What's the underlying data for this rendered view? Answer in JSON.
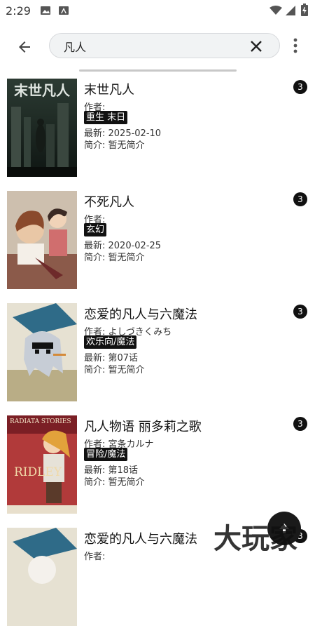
{
  "status_bar": {
    "time": "2:29"
  },
  "search": {
    "value": "凡人"
  },
  "results": [
    {
      "title": "末世凡人",
      "author": "作者:",
      "tags": "重生 末日",
      "latest": "最新: 2025-02-10",
      "intro": "简介: 暂无简介",
      "count": "3",
      "cover_text": "末世凡人"
    },
    {
      "title": "不死凡人",
      "author": "作者:",
      "tags": "玄幻",
      "latest": "最新: 2020-02-25",
      "intro": "简介: 暂无简介",
      "count": "3"
    },
    {
      "title": "恋爱的凡人与六魔法",
      "author": "作者: よしづきくみち",
      "tags": "欢乐向/魔法",
      "latest": "最新: 第07话",
      "intro": "简介: 暂无简介",
      "count": "3"
    },
    {
      "title": "凡人物语 丽多莉之歌",
      "author": "作者: 宮条カルナ",
      "tags": "冒险/魔法",
      "latest": "最新: 第18话",
      "intro": "简介: 暂无简介",
      "count": "3",
      "cover_text": "RADIATA STORIES",
      "cover_text2": "RIDLEY"
    },
    {
      "title": "恋爱的凡人与六魔法",
      "author": "作者:",
      "count": "3"
    }
  ],
  "watermark": "大玩家",
  "colors": {
    "badge": "#111111",
    "search_bg": "#f1f3f4",
    "fab": "#1a1a1a"
  }
}
